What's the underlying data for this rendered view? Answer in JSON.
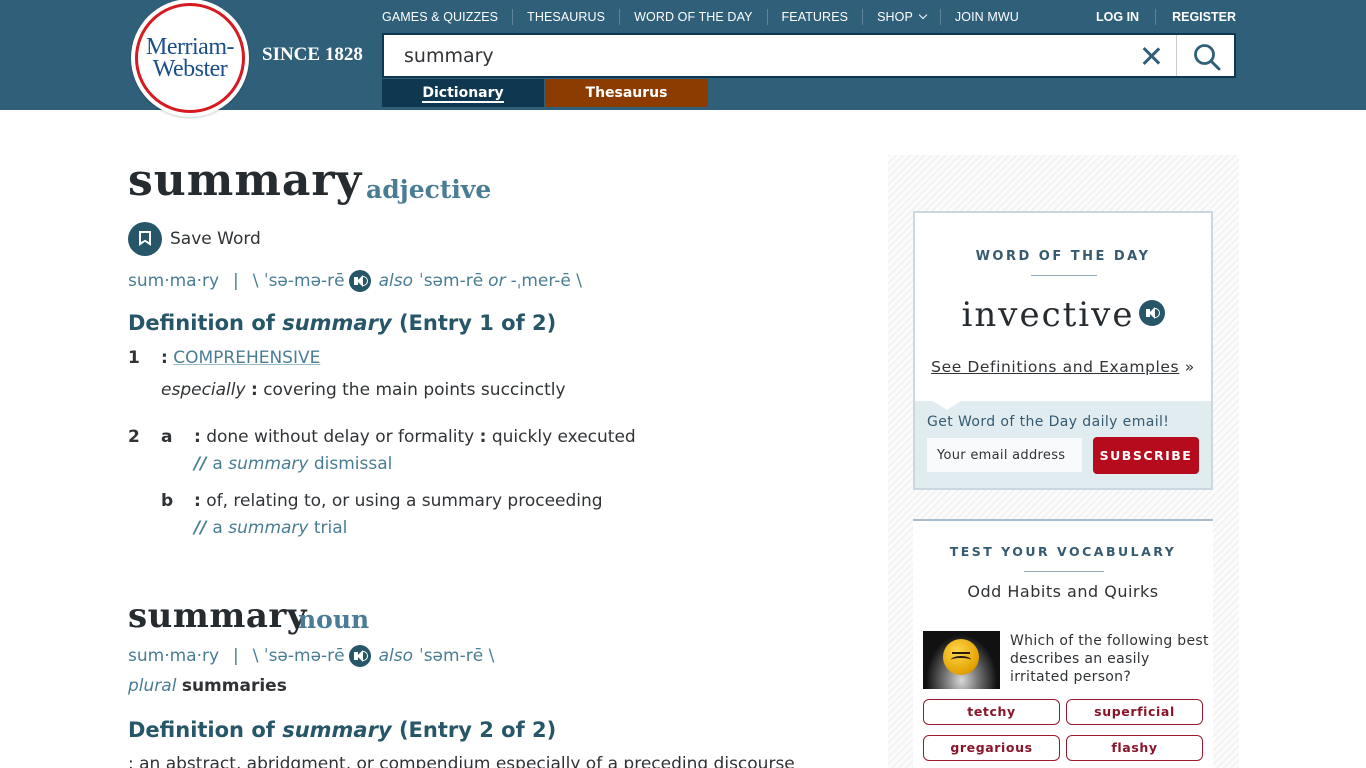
{
  "header": {
    "logo": {
      "line1": "Merriam-",
      "line2": "Webster"
    },
    "since": "SINCE 1828",
    "nav": [
      {
        "label": "GAMES & QUIZZES"
      },
      {
        "label": "THESAURUS"
      },
      {
        "label": "WORD OF THE DAY"
      },
      {
        "label": "FEATURES"
      },
      {
        "label": "SHOP",
        "has_dropdown": true
      },
      {
        "label": "JOIN MWU"
      }
    ],
    "auth": {
      "login": "LOG IN",
      "register": "REGISTER"
    },
    "search": {
      "value": "summary",
      "clear_icon": "close-icon",
      "search_icon": "search-icon"
    },
    "tabs": {
      "dictionary": "Dictionary",
      "thesaurus": "Thesaurus",
      "active": "Dictionary"
    }
  },
  "colors": {
    "header_bg": "#305f7a",
    "dictionary_tab": "#0f3850",
    "thesaurus_tab": "#8c3c00",
    "accent_blue": "#4a7d95",
    "heading_blue": "#265667",
    "subscribe_red": "#b50b1c",
    "logo_red": "#d71920"
  },
  "entry1": {
    "headword": "summary",
    "function_label": "adjective",
    "save_word": "Save Word",
    "syllables": "sum·ma·ry",
    "separator": "|",
    "pron_open": "\\ ˈsə-mə-rē",
    "also": "also",
    "pron_alt": "ˈsəm-rē",
    "or": "or",
    "pron_alt2": "-ˌmer-ē \\",
    "def_heading": {
      "prefix": "Definition of ",
      "word": "summary",
      "suffix": " (Entry 1 of 2)"
    },
    "senses": [
      {
        "num": "1",
        "colon": ":",
        "link": "COMPREHENSIVE",
        "sub_label": "especially",
        "sub_text": "covering the main points succinctly"
      },
      {
        "num": "2",
        "letter": "a",
        "text1": "done without delay or formality",
        "text2": "quickly executed",
        "example_a": "a",
        "example_word": "summary",
        "example_rest": "dismissal"
      },
      {
        "letter": "b",
        "text": "of, relating to, or using a summary proceeding",
        "example_a": "a",
        "example_word": "summary",
        "example_rest": "trial"
      }
    ]
  },
  "entry2": {
    "headword": "summary",
    "function_label": "noun",
    "syllables": "sum·ma·ry",
    "separator": "|",
    "pron_open": "\\ ˈsə-mə-rē",
    "also": "also",
    "pron_alt": "ˈsəm-rē \\",
    "plural_label": "plural",
    "plural_form": "summaries",
    "def_heading": {
      "prefix": "Definition of ",
      "word": "summary",
      "suffix": " (Entry 2 of 2)"
    },
    "def_text": ": an abstract, abridgment, or compendium especially of a preceding discourse"
  },
  "sidebar": {
    "wod": {
      "title": "WORD OF THE DAY",
      "word": "invective",
      "link": "See Definitions and Examples",
      "link_suffix": "»",
      "email_label": "Get Word of the Day daily email!",
      "email_placeholder": "Your email address",
      "subscribe": "SUBSCRIBE"
    },
    "vocab": {
      "title": "TEST YOUR VOCABULARY",
      "subtitle": "Odd Habits and Quirks",
      "question": "Which of the following best describes an easily irritated person?",
      "answers": [
        "tetchy",
        "superficial",
        "gregarious",
        "flashy"
      ]
    }
  }
}
